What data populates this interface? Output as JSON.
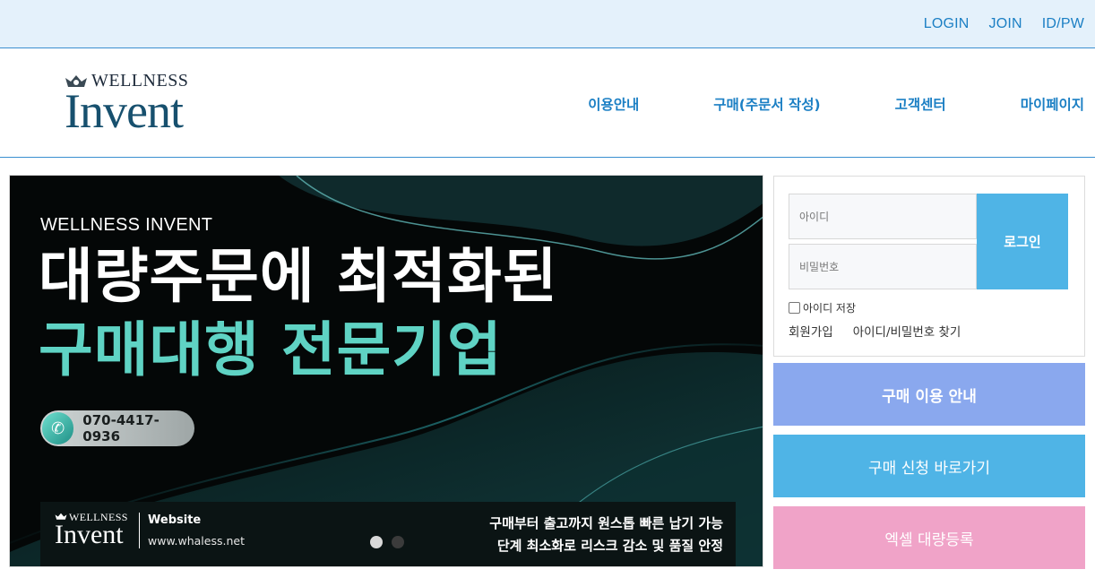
{
  "topbar": {
    "links": [
      "LOGIN",
      "JOIN",
      "ID/PW"
    ]
  },
  "header": {
    "logo_top": "WELLNESS",
    "logo_main": "Invent",
    "nav": [
      "이용안내",
      "구매(주문서 작성)",
      "고객센터",
      "마이페이지"
    ]
  },
  "banner": {
    "eyebrow": "WELLNESS INVENT",
    "headline1": "대량주문에 최적화된",
    "headline2": "구매대행 전문기업",
    "phone": "070-4417-0936",
    "footer": {
      "logo_top": "WELLNESS",
      "logo_main": "Invent",
      "website_label": "Website",
      "website_url": "www.whaless.net",
      "line1": "구매부터 출고까지 원스톱 빠른 납기 가능",
      "line2": "단계 최소화로 리스크 감소 및 품질 안정"
    },
    "slides": {
      "total": 2,
      "active": 1
    }
  },
  "login": {
    "id_placeholder": "아이디",
    "pw_placeholder": "비밀번호",
    "button": "로그인",
    "remember": "아이디 저장",
    "join": "회원가입",
    "find": "아이디/비밀번호 찾기"
  },
  "side_buttons": [
    "구매 이용 안내",
    "구매 신청 바로가기",
    "엑셀 대량등록"
  ],
  "colors": {
    "accent": "#1b7fc4",
    "topbar_bg": "#e4f1fb",
    "login_btn": "#4fb4e6",
    "guide_btn": "#8aa8ee",
    "apply_btn": "#4fb4e6",
    "excel_btn": "#f0a3c8",
    "headline_teal": "#5fd3c4"
  }
}
